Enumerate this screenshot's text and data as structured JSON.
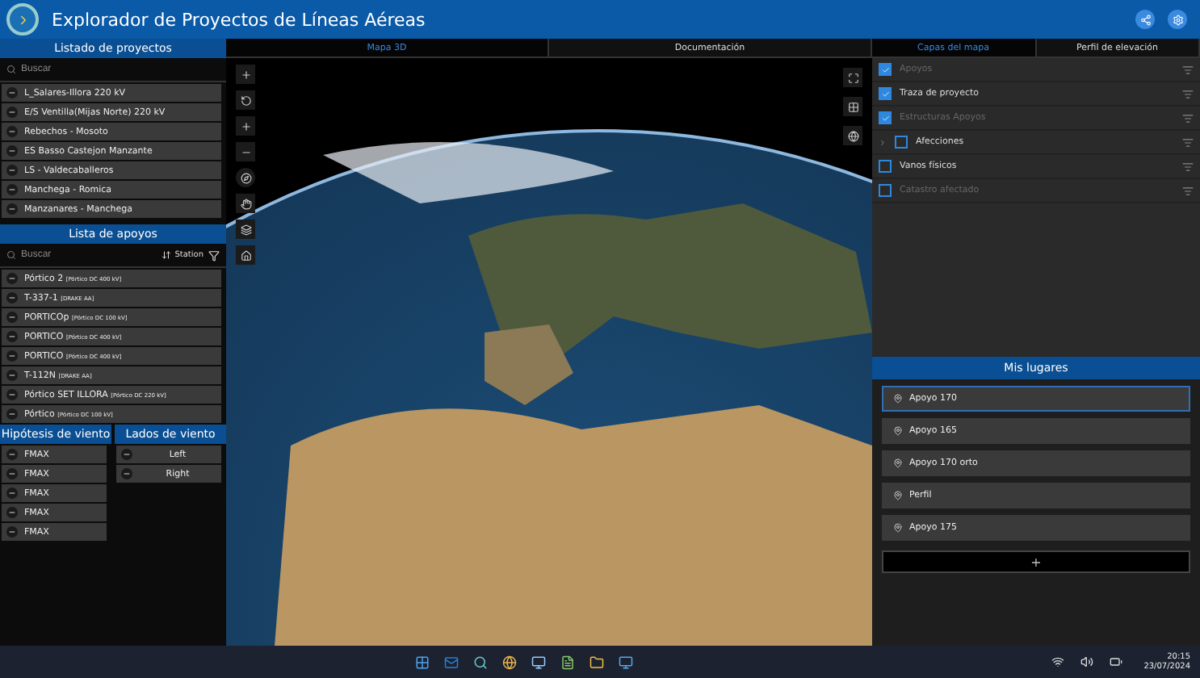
{
  "window": {
    "title": "Explorador de Proyectos de Líneas Aéreas"
  },
  "projects": {
    "title": "Listado de proyectos",
    "search": {
      "placeholder": "Buscar"
    },
    "items": [
      {
        "label": "L_Salares-Illora 220 kV"
      },
      {
        "label": "E/S Ventilla(Mijas Norte) 220 kV"
      },
      {
        "label": "Rebechos - Mosoto"
      },
      {
        "label": "ES Basso Castejon Manzante"
      },
      {
        "label": "LS - Valdecaballeros"
      },
      {
        "label": "Manchega - Romica"
      },
      {
        "label": "Manzanares - Manchega"
      }
    ]
  },
  "supports": {
    "title": "Lista de apoyos",
    "search": {
      "placeholder": "Buscar"
    },
    "sort": "Station",
    "items": [
      {
        "name": "Pórtico 2",
        "type": "[Pórtico DC 400 kV]"
      },
      {
        "name": "T-337-1",
        "type": "[DRAKE AA]"
      },
      {
        "name": "PORTICOp",
        "type": "[Pórtico DC 100 kV]"
      },
      {
        "name": "PORTICO",
        "type": "[Pórtico DC 400 kV]"
      },
      {
        "name": "PORTICO",
        "type": "[Pórtico DC 400 kV]"
      },
      {
        "name": "T-112N",
        "type": "[DRAKE AA]"
      },
      {
        "name": "Pórtico SET ILLORA",
        "type": "[Pórtico DC 220 kV]"
      },
      {
        "name": "Pórtico",
        "type": "[Pórtico DC 100 kV]"
      }
    ]
  },
  "wind_hypotheses": {
    "title": "Hipótesis de viento",
    "items": [
      "FMAX",
      "FMAX",
      "FMAX",
      "FMAX",
      "FMAX"
    ]
  },
  "wind_sides": {
    "title": "Lados de viento",
    "items": [
      "Left",
      "Right"
    ]
  },
  "center_tabs": [
    {
      "label": "Mapa 3D",
      "selected": true
    },
    {
      "label": "Documentación",
      "selected": false
    }
  ],
  "right_tabs": [
    {
      "label": "Capas del mapa",
      "selected": true
    },
    {
      "label": "Perfil de elevación",
      "selected": false
    }
  ],
  "layers": [
    {
      "label": "Apoyos",
      "checked": true,
      "disabled": true,
      "expandable": false
    },
    {
      "label": "Traza de proyecto",
      "checked": true,
      "disabled": false,
      "expandable": false
    },
    {
      "label": "Estructuras Apoyos",
      "checked": true,
      "disabled": true,
      "expandable": false
    },
    {
      "label": "Afecciones",
      "checked": false,
      "disabled": false,
      "expandable": true
    },
    {
      "label": "Vanos físicos",
      "checked": false,
      "disabled": false,
      "expandable": false
    },
    {
      "label": "Catastro afectado",
      "checked": false,
      "disabled": true,
      "expandable": false
    }
  ],
  "places": {
    "title": "Mis lugares",
    "items": [
      {
        "label": "Apoyo 170",
        "selected": true
      },
      {
        "label": "Apoyo 165",
        "selected": false
      },
      {
        "label": "Apoyo 170 orto",
        "selected": false
      },
      {
        "label": "Perfil",
        "selected": false
      },
      {
        "label": "Apoyo 175",
        "selected": false
      }
    ],
    "add": "+"
  },
  "taskbar": {
    "time": "20:15",
    "date": "23/07/2024"
  }
}
